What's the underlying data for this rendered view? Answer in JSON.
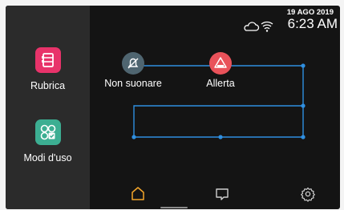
{
  "status": {
    "date": "19 AGO 2019",
    "time": "6:23 AM",
    "icons": [
      "cloud-icon",
      "wifi-icon"
    ]
  },
  "sidebar": {
    "apps": [
      {
        "label": "Rubrica",
        "icon": "address-book-icon",
        "color": "#e8336a"
      },
      {
        "label": "Modi d'uso",
        "icon": "usage-modes-icon",
        "color": "#3cae92"
      }
    ]
  },
  "tiles": [
    {
      "label": "Non suonare",
      "icon": "bell-muted-icon",
      "color": "#4f6570"
    },
    {
      "label": "Allerta",
      "icon": "alert-triangle-icon",
      "color": "#e9525a"
    }
  ],
  "navbar": {
    "items": [
      "home-icon",
      "chat-icon",
      "settings-icon"
    ],
    "active_color": "#f3a52a",
    "inactive_color": "#cfcfcf"
  },
  "colors": {
    "connector": "#2f8fe0",
    "background": "#141414",
    "sidebar": "#2b2b2b"
  }
}
